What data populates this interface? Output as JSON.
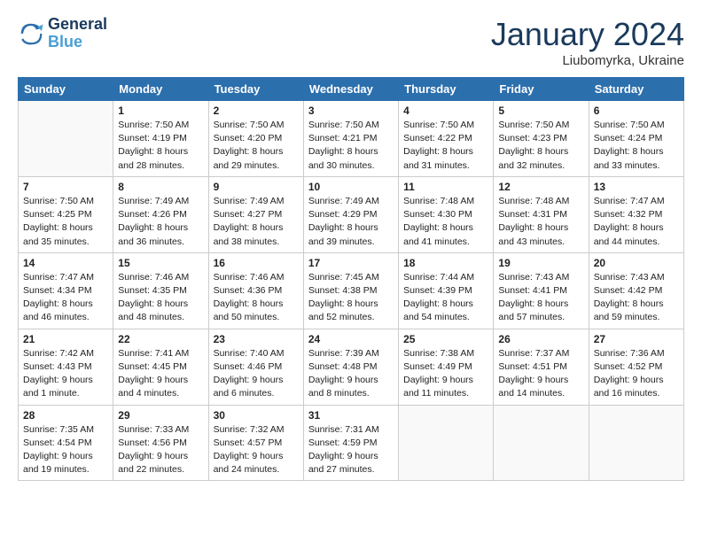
{
  "header": {
    "logo_line1": "General",
    "logo_line2": "Blue",
    "month": "January 2024",
    "location": "Liubomyrka, Ukraine"
  },
  "weekdays": [
    "Sunday",
    "Monday",
    "Tuesday",
    "Wednesday",
    "Thursday",
    "Friday",
    "Saturday"
  ],
  "weeks": [
    [
      {
        "day": "",
        "empty": true
      },
      {
        "day": "1",
        "sunrise": "7:50 AM",
        "sunset": "4:19 PM",
        "daylight": "8 hours and 28 minutes."
      },
      {
        "day": "2",
        "sunrise": "7:50 AM",
        "sunset": "4:20 PM",
        "daylight": "8 hours and 29 minutes."
      },
      {
        "day": "3",
        "sunrise": "7:50 AM",
        "sunset": "4:21 PM",
        "daylight": "8 hours and 30 minutes."
      },
      {
        "day": "4",
        "sunrise": "7:50 AM",
        "sunset": "4:22 PM",
        "daylight": "8 hours and 31 minutes."
      },
      {
        "day": "5",
        "sunrise": "7:50 AM",
        "sunset": "4:23 PM",
        "daylight": "8 hours and 32 minutes."
      },
      {
        "day": "6",
        "sunrise": "7:50 AM",
        "sunset": "4:24 PM",
        "daylight": "8 hours and 33 minutes."
      }
    ],
    [
      {
        "day": "7",
        "sunrise": "7:50 AM",
        "sunset": "4:25 PM",
        "daylight": "8 hours and 35 minutes."
      },
      {
        "day": "8",
        "sunrise": "7:49 AM",
        "sunset": "4:26 PM",
        "daylight": "8 hours and 36 minutes."
      },
      {
        "day": "9",
        "sunrise": "7:49 AM",
        "sunset": "4:27 PM",
        "daylight": "8 hours and 38 minutes."
      },
      {
        "day": "10",
        "sunrise": "7:49 AM",
        "sunset": "4:29 PM",
        "daylight": "8 hours and 39 minutes."
      },
      {
        "day": "11",
        "sunrise": "7:48 AM",
        "sunset": "4:30 PM",
        "daylight": "8 hours and 41 minutes."
      },
      {
        "day": "12",
        "sunrise": "7:48 AM",
        "sunset": "4:31 PM",
        "daylight": "8 hours and 43 minutes."
      },
      {
        "day": "13",
        "sunrise": "7:47 AM",
        "sunset": "4:32 PM",
        "daylight": "8 hours and 44 minutes."
      }
    ],
    [
      {
        "day": "14",
        "sunrise": "7:47 AM",
        "sunset": "4:34 PM",
        "daylight": "8 hours and 46 minutes."
      },
      {
        "day": "15",
        "sunrise": "7:46 AM",
        "sunset": "4:35 PM",
        "daylight": "8 hours and 48 minutes."
      },
      {
        "day": "16",
        "sunrise": "7:46 AM",
        "sunset": "4:36 PM",
        "daylight": "8 hours and 50 minutes."
      },
      {
        "day": "17",
        "sunrise": "7:45 AM",
        "sunset": "4:38 PM",
        "daylight": "8 hours and 52 minutes."
      },
      {
        "day": "18",
        "sunrise": "7:44 AM",
        "sunset": "4:39 PM",
        "daylight": "8 hours and 54 minutes."
      },
      {
        "day": "19",
        "sunrise": "7:43 AM",
        "sunset": "4:41 PM",
        "daylight": "8 hours and 57 minutes."
      },
      {
        "day": "20",
        "sunrise": "7:43 AM",
        "sunset": "4:42 PM",
        "daylight": "8 hours and 59 minutes."
      }
    ],
    [
      {
        "day": "21",
        "sunrise": "7:42 AM",
        "sunset": "4:43 PM",
        "daylight": "9 hours and 1 minute."
      },
      {
        "day": "22",
        "sunrise": "7:41 AM",
        "sunset": "4:45 PM",
        "daylight": "9 hours and 4 minutes."
      },
      {
        "day": "23",
        "sunrise": "7:40 AM",
        "sunset": "4:46 PM",
        "daylight": "9 hours and 6 minutes."
      },
      {
        "day": "24",
        "sunrise": "7:39 AM",
        "sunset": "4:48 PM",
        "daylight": "9 hours and 8 minutes."
      },
      {
        "day": "25",
        "sunrise": "7:38 AM",
        "sunset": "4:49 PM",
        "daylight": "9 hours and 11 minutes."
      },
      {
        "day": "26",
        "sunrise": "7:37 AM",
        "sunset": "4:51 PM",
        "daylight": "9 hours and 14 minutes."
      },
      {
        "day": "27",
        "sunrise": "7:36 AM",
        "sunset": "4:52 PM",
        "daylight": "9 hours and 16 minutes."
      }
    ],
    [
      {
        "day": "28",
        "sunrise": "7:35 AM",
        "sunset": "4:54 PM",
        "daylight": "9 hours and 19 minutes."
      },
      {
        "day": "29",
        "sunrise": "7:33 AM",
        "sunset": "4:56 PM",
        "daylight": "9 hours and 22 minutes."
      },
      {
        "day": "30",
        "sunrise": "7:32 AM",
        "sunset": "4:57 PM",
        "daylight": "9 hours and 24 minutes."
      },
      {
        "day": "31",
        "sunrise": "7:31 AM",
        "sunset": "4:59 PM",
        "daylight": "9 hours and 27 minutes."
      },
      {
        "day": "",
        "empty": true
      },
      {
        "day": "",
        "empty": true
      },
      {
        "day": "",
        "empty": true
      }
    ]
  ]
}
